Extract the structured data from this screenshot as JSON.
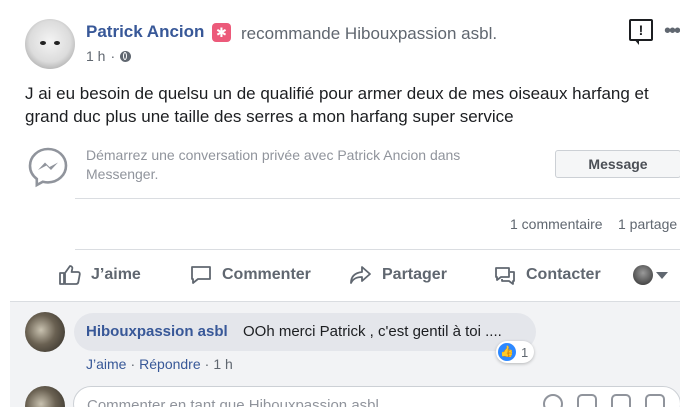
{
  "post": {
    "author_name": "Patrick Ancion",
    "badge_icon": "recommendation-star-icon",
    "recommends_text": "recommande Hibouxpassion asbl.",
    "time": "1 h",
    "time_separator": "·",
    "text": "J ai eu besoin de quelsu un de qualifié pour armer deux de mes oiseaux harfang et grand duc plus une taille des serres a mon harfang super service"
  },
  "messenger": {
    "prompt": "Démarrez une conversation privée avec Patrick Ancion dans Messenger.",
    "button_label": "Message"
  },
  "stats": {
    "comments": "1 commentaire",
    "shares": "1 partage"
  },
  "actions": {
    "like": "J’aime",
    "comment": "Commenter",
    "share": "Partager",
    "contact": "Contacter"
  },
  "comment": {
    "author": "Hibouxpassion asbl",
    "text": "OOh merci Patrick , c'est gentil à toi ....",
    "like_count": "1",
    "like_link": "J’aime",
    "reply_link": "Répondre",
    "time": "1 h",
    "separator": "·"
  },
  "composer": {
    "placeholder": "Commenter en tant que Hibouxpassion asbl"
  },
  "colors": {
    "link": "#385898",
    "muted": "#606770",
    "like_blue": "#2d88ff"
  }
}
